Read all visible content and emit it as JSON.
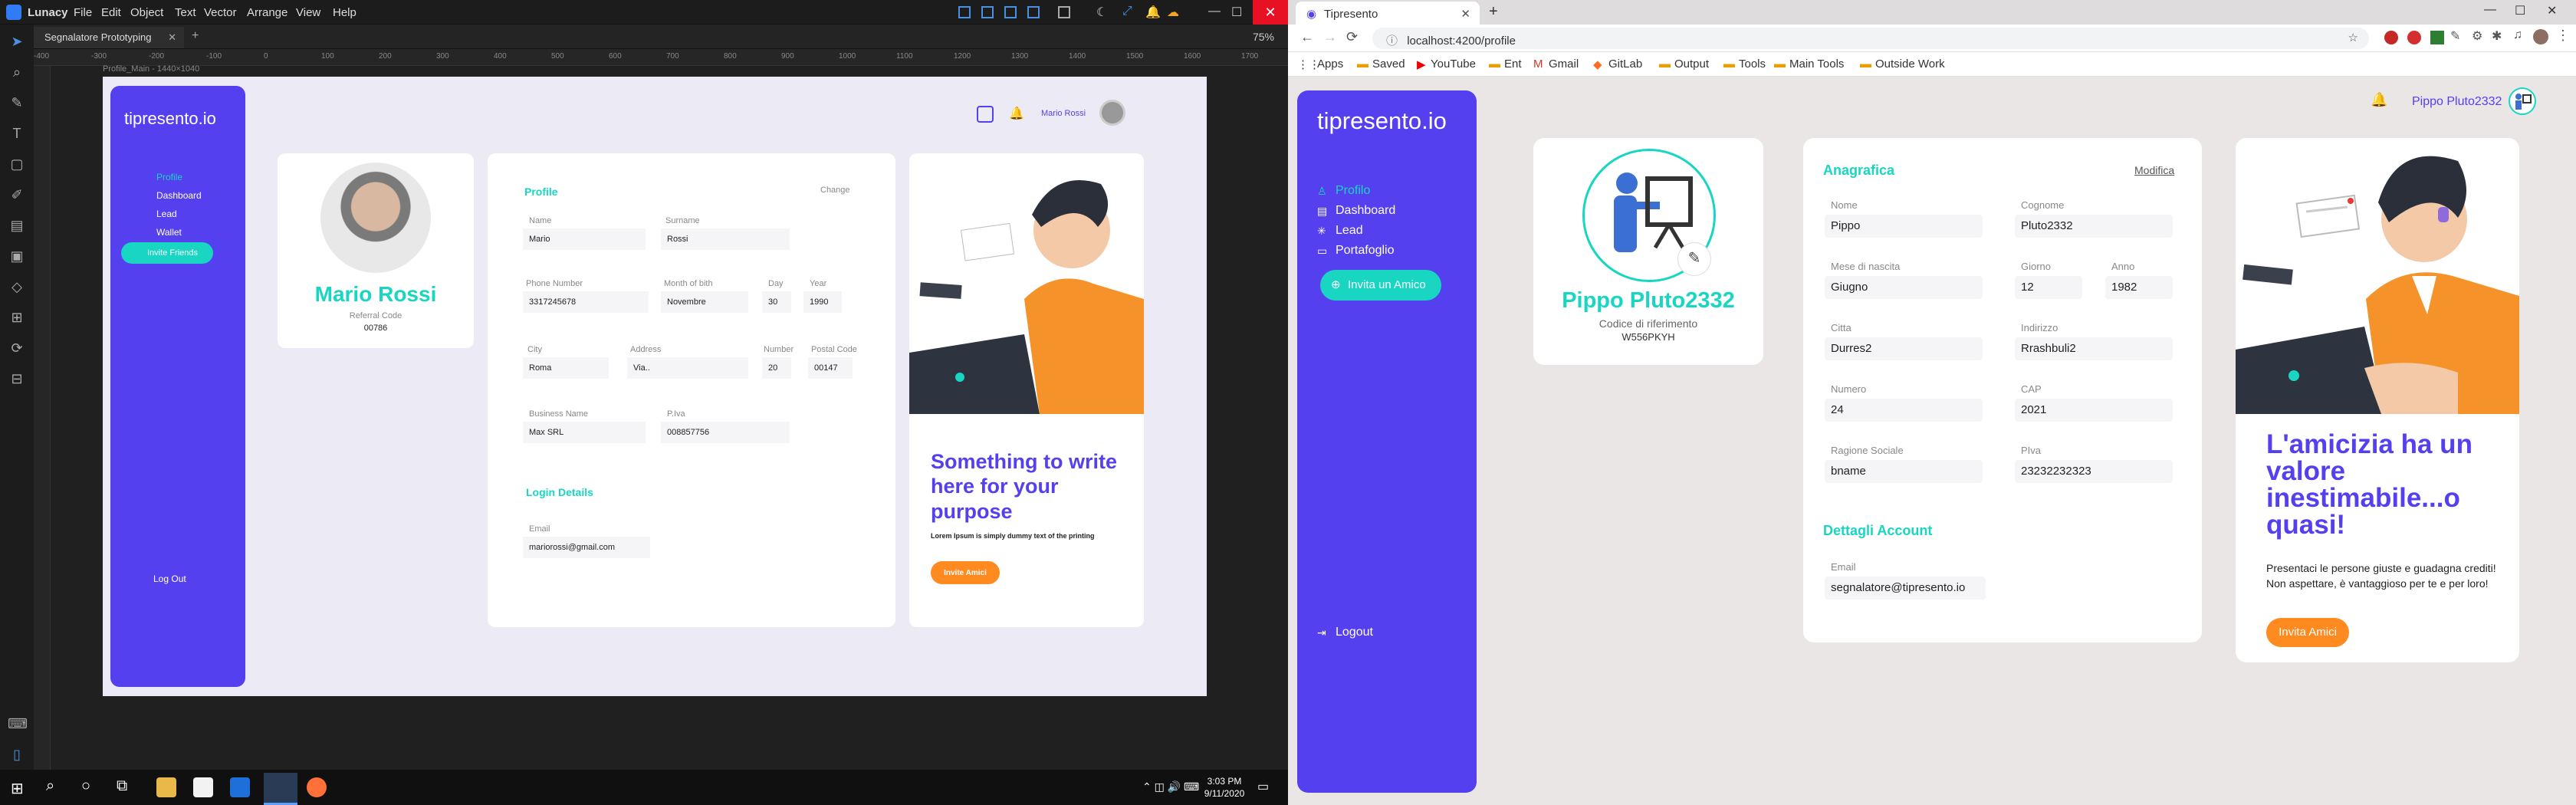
{
  "lunacy": {
    "app_name": "Lunacy",
    "menu": [
      "File",
      "Edit",
      "Object",
      "Text",
      "Vector",
      "Arrange",
      "View",
      "Help"
    ],
    "tab_title": "Segnalatore Prototyping",
    "zoom": "75%",
    "ruler_ticks": [
      "-400",
      "-300",
      "-200",
      "-100",
      "0",
      "100",
      "200",
      "300",
      "400",
      "500",
      "600",
      "700",
      "800",
      "900",
      "1000",
      "1100",
      "1200",
      "1300",
      "1400",
      "1500",
      "1600",
      "1700"
    ],
    "artboard_label": "Profile_Main - 1440×1040",
    "artboard": {
      "logo": "tipresento.io",
      "nav": [
        "Profile",
        "Dashboard",
        "Lead",
        "Wallet"
      ],
      "invite": "Invite Friends",
      "logout": "Log Out",
      "user_name": "Mario Rossi",
      "referral_label": "Referral Code",
      "referral_code": "00786",
      "profile_title": "Profile",
      "change": "Change",
      "fields": {
        "name_label": "Name",
        "name": "Mario",
        "surname_label": "Surname",
        "surname": "Rossi",
        "phone_label": "Phone Number",
        "phone": "3317245678",
        "month_label": "Month of bith",
        "month": "Novembre",
        "day_label": "Day",
        "day": "30",
        "year_label": "Year",
        "year": "1990",
        "city_label": "City",
        "city": "Roma",
        "address_label": "Address",
        "address": "Via..",
        "number_label": "Number",
        "number": "20",
        "postal_label": "Postal Code",
        "postal": "00147",
        "business_label": "Business Name",
        "business": "Max SRL",
        "piva_label": "P.Iva",
        "piva": "008857756"
      },
      "login_title": "Login Details",
      "email_label": "Email",
      "email": "mariorossi@gmail.com",
      "promo_title": "Something to write here for your purpose",
      "promo_text": "Lorem Ipsum is simply dummy text of the printing",
      "promo_button": "Invite Amici"
    },
    "clock_time": "3:03 PM",
    "clock_date": "9/11/2020"
  },
  "chrome": {
    "tab_title": "Tipresento",
    "url": "localhost:4200/profile",
    "bookmarks": [
      "Apps",
      "Saved",
      "YouTube",
      "Ent",
      "Gmail",
      "GitLab",
      "Output",
      "Tools",
      "Main Tools",
      "Outside Work"
    ]
  },
  "app": {
    "logo": "tipresento.io",
    "nav": [
      {
        "label": "Profilo",
        "icon": "user-icon",
        "active": true
      },
      {
        "label": "Dashboard",
        "icon": "dashboard-icon"
      },
      {
        "label": "Lead",
        "icon": "asterisk-icon"
      },
      {
        "label": "Portafoglio",
        "icon": "wallet-icon"
      }
    ],
    "invite_button": "Invita un Amico",
    "logout": "Logout",
    "header_user": "Pippo Pluto2332",
    "profile": {
      "name": "Pippo Pluto2332",
      "ref_label": "Codice di riferimento",
      "ref_code": "W556PKYH"
    },
    "anagrafica": {
      "title": "Anagrafica",
      "edit": "Modifica",
      "nome_label": "Nome",
      "nome": "Pippo",
      "cognome_label": "Cognome",
      "cognome": "Pluto2332",
      "mese_label": "Mese di nascita",
      "mese": "Giugno",
      "giorno_label": "Giorno",
      "giorno": "12",
      "anno_label": "Anno",
      "anno": "1982",
      "citta_label": "Citta",
      "citta": "Durres2",
      "indirizzo_label": "Indirizzo",
      "indirizzo": "Rrashbuli2",
      "numero_label": "Numero",
      "numero": "24",
      "cap_label": "CAP",
      "cap": "2021",
      "ragione_label": "Ragione Sociale",
      "ragione": "bname",
      "piva_label": "PIva",
      "piva": "23232232323"
    },
    "account": {
      "title": "Dettagli Account",
      "email_label": "Email",
      "email": "segnalatore@tipresento.io"
    },
    "promo": {
      "title": "L'amicizia ha un valore inestimabile...o quasi!",
      "text": "Presentaci le persone giuste e guadagna crediti! Non aspettare, è vantaggioso per te e per loro!",
      "button": "Invita Amici"
    }
  },
  "colors": {
    "brand_purple": "#5540f0",
    "accent_teal": "#18d6c2",
    "accent_orange": "#ff8a1f"
  }
}
